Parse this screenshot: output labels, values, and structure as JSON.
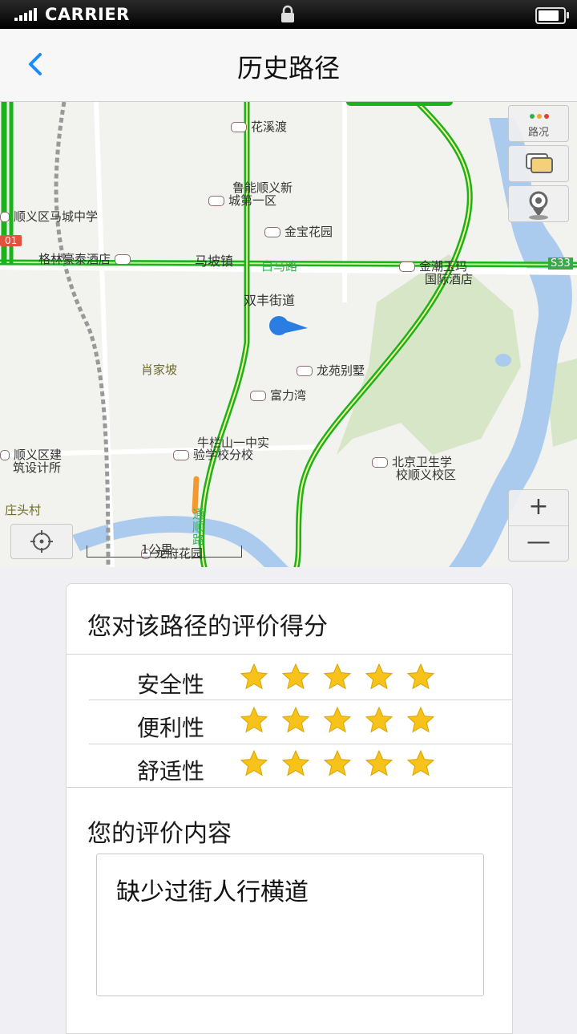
{
  "status_bar": {
    "carrier": "CARRIER",
    "battery_level": 0.9
  },
  "nav": {
    "title": "历史路径",
    "back_icon": "chevron-left-icon",
    "accent_color": "#1a8cff"
  },
  "map": {
    "labels": {
      "huaxidu": "花溪渡",
      "luneng_1": "鲁能顺义新",
      "luneng_2": "城第一区",
      "jinbao": "金宝花园",
      "machengzhong": "顺义区马城中学",
      "gelin": "格林豪泰酒店",
      "mapo": "马坡镇",
      "baima": "白马路",
      "jinchao_1": "金潮玉玛",
      "jinchao_2": "国际酒店",
      "shuangfeng": "双丰街道",
      "xiaojiapo": "肖家坡",
      "longyuan": "龙苑别墅",
      "fuliwan": "富力湾",
      "niulanshan_1": "牛栏山一中实",
      "niulanshan_2": "验学校分校",
      "sheji_1": "顺义区建",
      "sheji_2": "筑设计所",
      "beiwei_1": "北京卫生学",
      "beiwei_2": "校顺义校区",
      "zhuangtou": "庄头村",
      "tongshun": "通顺路",
      "longfu": "龙府花园",
      "s33": "S33",
      "r101": "01"
    },
    "traffic_button_label": "路况",
    "zoom_in": "+",
    "zoom_out": "—",
    "scale": "1公里"
  },
  "review": {
    "header": "您对该路径的评价得分",
    "ratings": [
      {
        "label": "安全性",
        "stars": 5
      },
      {
        "label": "便利性",
        "stars": 5
      },
      {
        "label": "舒适性",
        "stars": 5
      }
    ],
    "comment_title": "您的评价内容",
    "comment_text": "缺少过街人行横道",
    "star_color": "#f7c21a"
  }
}
